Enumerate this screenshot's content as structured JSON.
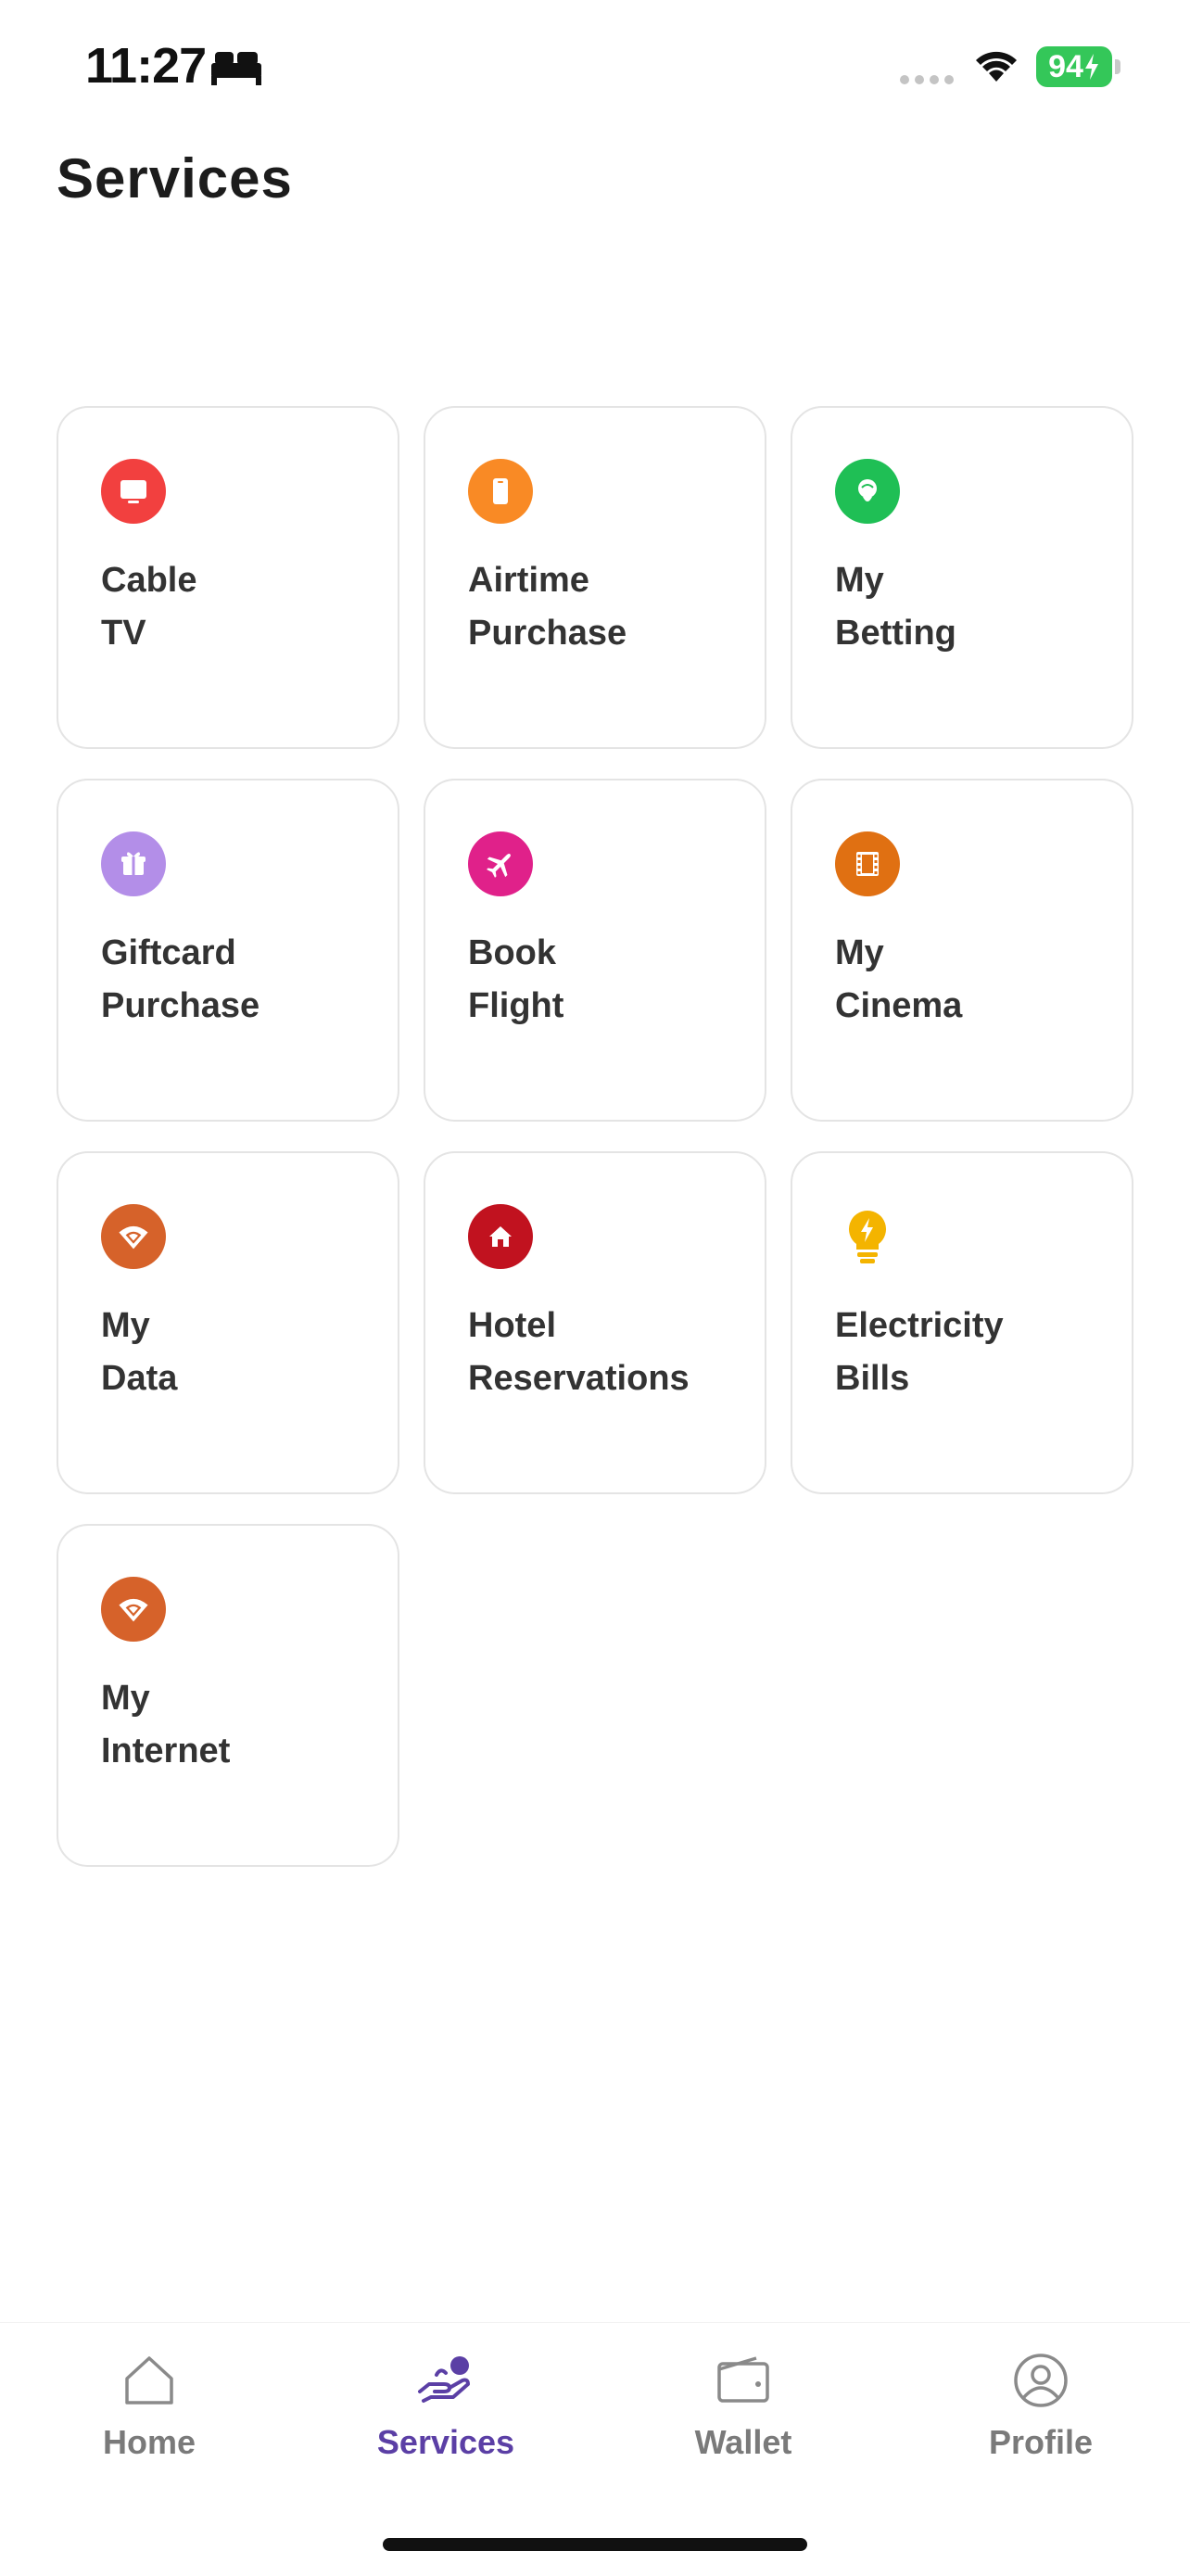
{
  "status_bar": {
    "time": "11:27",
    "battery": "94"
  },
  "page": {
    "title": "Services"
  },
  "services": [
    {
      "line1": "Cable",
      "line2": "TV",
      "icon": "tv-icon",
      "color": "#f2403f"
    },
    {
      "line1": "Airtime",
      "line2": "Purchase",
      "icon": "phone-icon",
      "color": "#f98a25"
    },
    {
      "line1": "My",
      "line2": "Betting",
      "icon": "ball-icon",
      "color": "#1fbf55"
    },
    {
      "line1": "Giftcard",
      "line2": "Purchase",
      "icon": "gift-icon",
      "color": "#b38ee8"
    },
    {
      "line1": "Book",
      "line2": "Flight",
      "icon": "airplane-icon",
      "color": "#e0218a"
    },
    {
      "line1": "My",
      "line2": "Cinema",
      "icon": "film-icon",
      "color": "#e07012"
    },
    {
      "line1": "My",
      "line2": "Data",
      "icon": "wifi-icon",
      "color": "#d6622a"
    },
    {
      "line1": "Hotel",
      "line2": "Reservations",
      "icon": "house-icon",
      "color": "#c1121f"
    },
    {
      "line1": "Electricity",
      "line2": "Bills",
      "icon": "lightbulb-icon",
      "color": "#f4b400"
    },
    {
      "line1": "My",
      "line2": "Internet",
      "icon": "wifi-icon",
      "color": "#d6622a"
    }
  ],
  "tab_bar": {
    "home": "Home",
    "services": "Services",
    "wallet": "Wallet",
    "profile": "Profile",
    "active_color": "#5b3fa5",
    "inactive_color": "#7a7a7a"
  }
}
